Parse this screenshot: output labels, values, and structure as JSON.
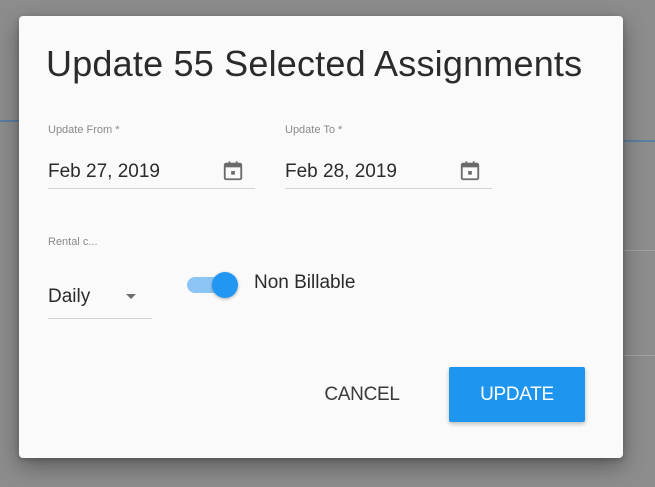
{
  "dialog": {
    "title": "Update 55 Selected Assignments",
    "update_from": {
      "label": "Update From *",
      "value": "Feb 27, 2019",
      "icon": "calendar-icon"
    },
    "update_to": {
      "label": "Update To *",
      "value": "Feb 28, 2019",
      "icon": "calendar-icon"
    },
    "rental": {
      "label": "Rental c...",
      "value": "Daily",
      "icon": "dropdown-arrow-icon"
    },
    "billable_toggle": {
      "label": "Non Billable",
      "on": true
    },
    "buttons": {
      "cancel": "CANCEL",
      "update": "UPDATE"
    }
  },
  "colors": {
    "accent": "#2196f3",
    "backdrop": "#8d8d8d",
    "dialog_bg": "#fafafa"
  }
}
